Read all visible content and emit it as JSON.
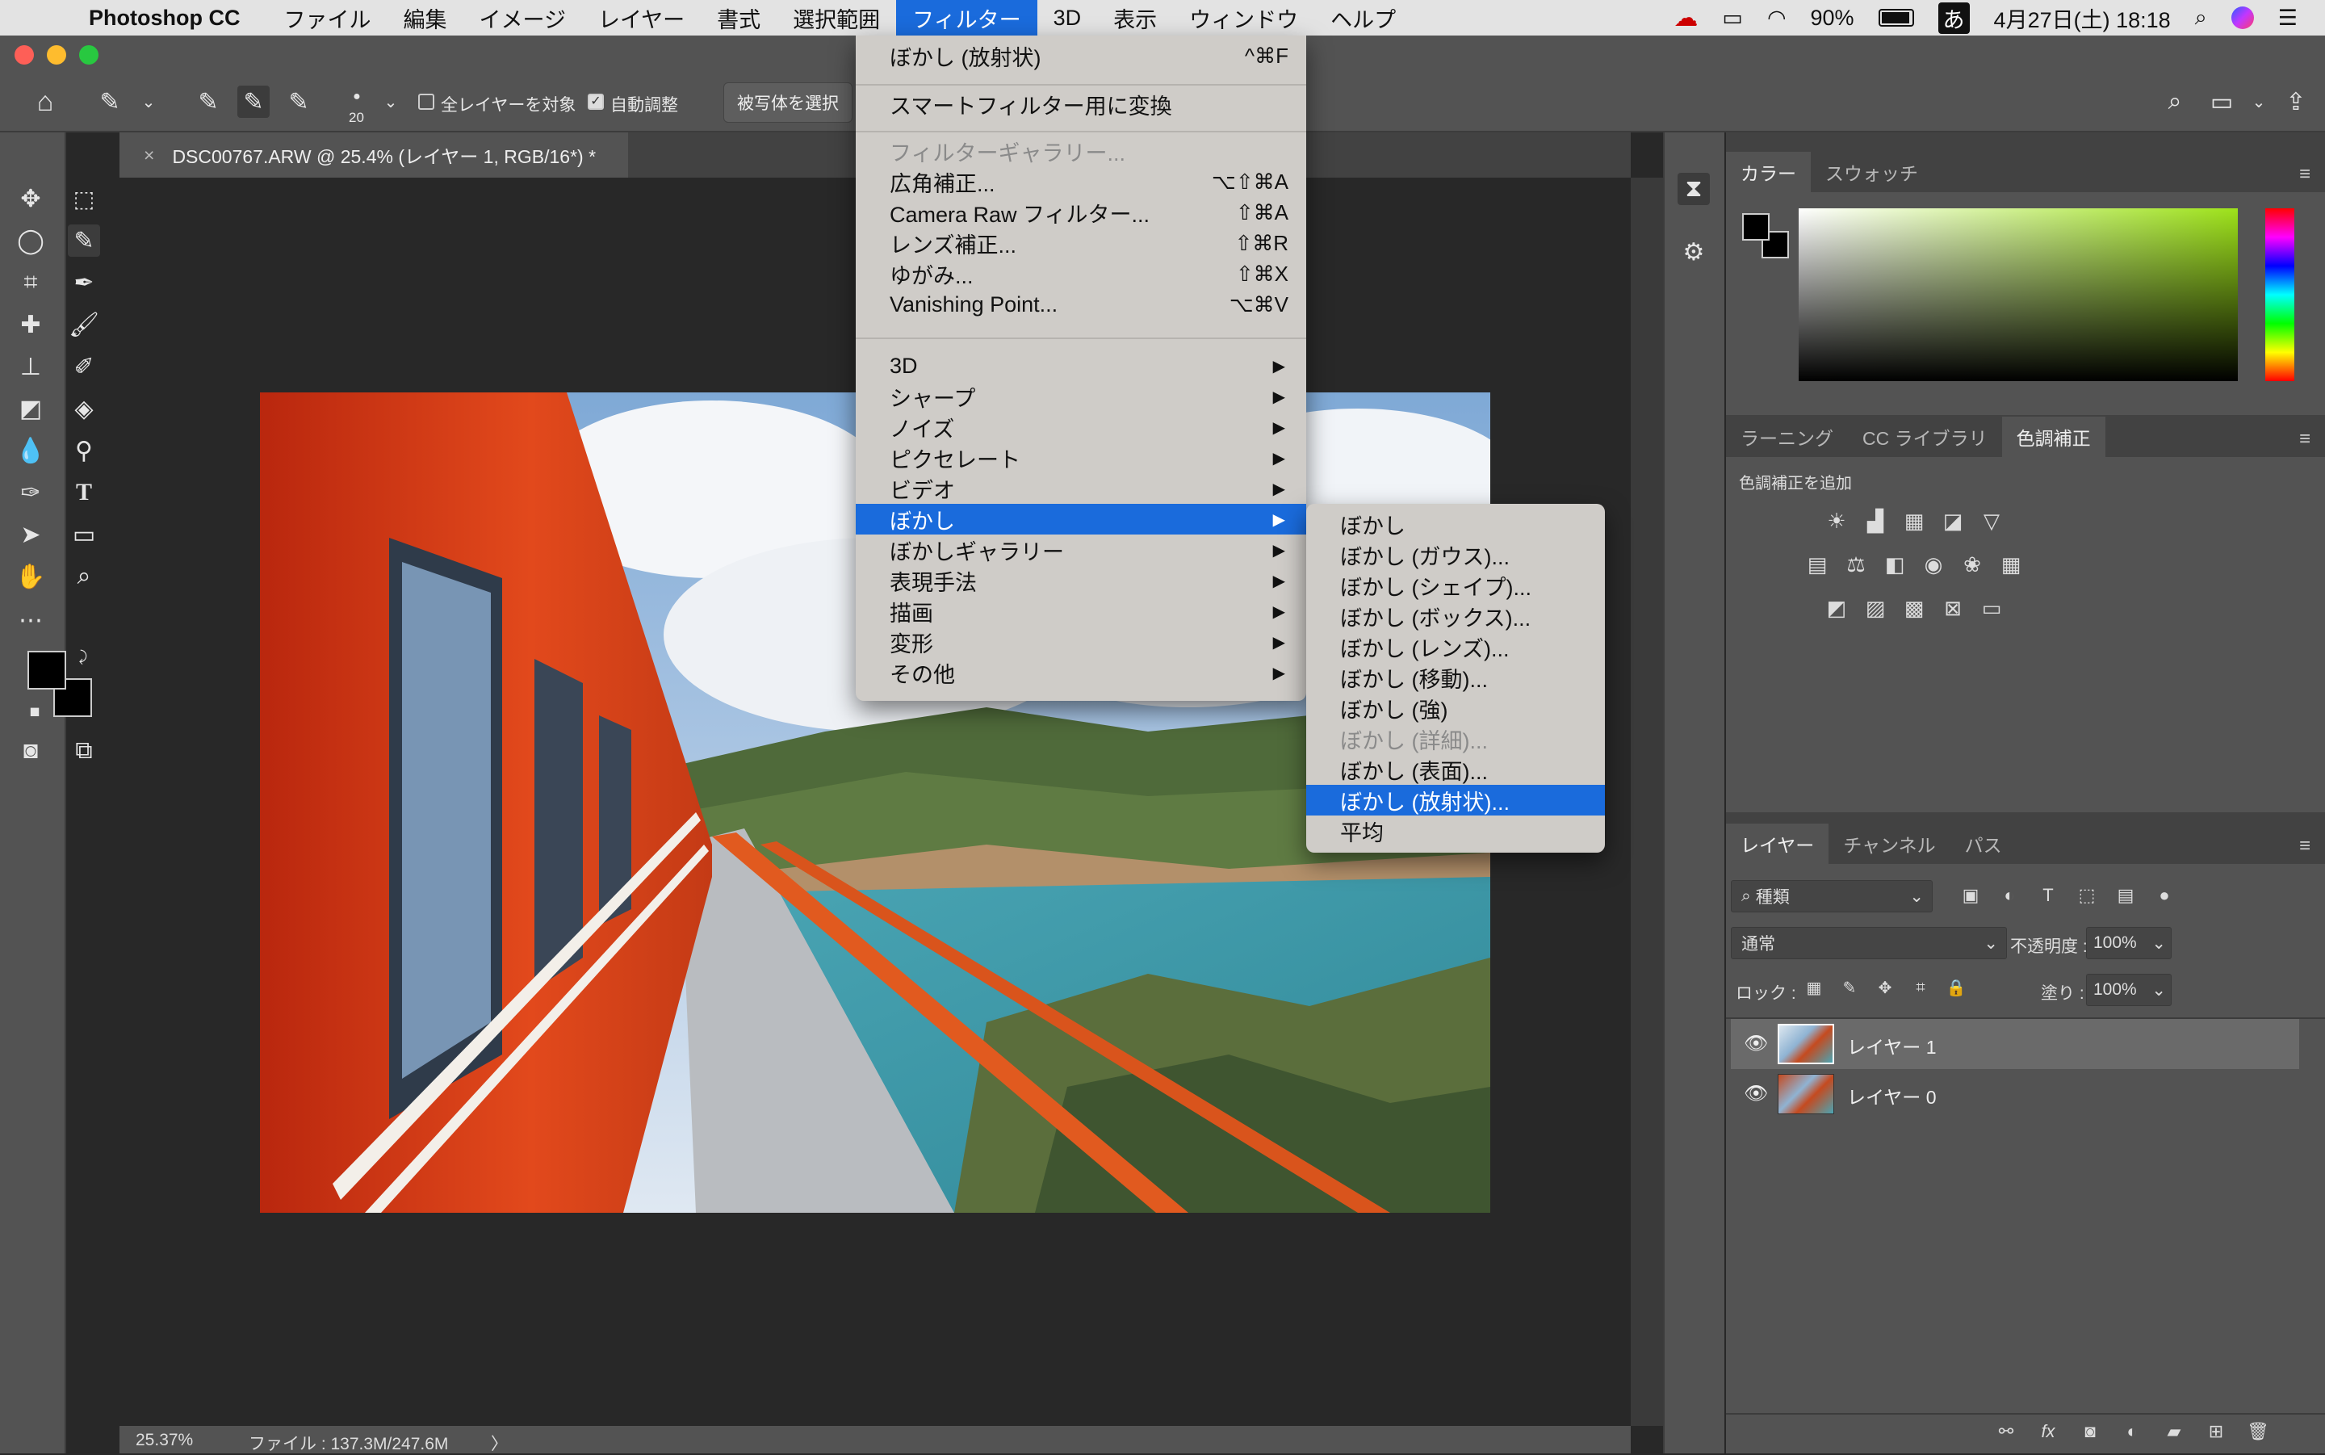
{
  "menubar": {
    "app_name": "Photoshop CC",
    "items": [
      "ファイル",
      "編集",
      "イメージ",
      "レイヤー",
      "書式",
      "選択範囲",
      "フィルター",
      "3D",
      "表示",
      "ウィンドウ",
      "ヘルプ"
    ],
    "battery": "90%",
    "input_method": "あ",
    "datetime": "4月27日(土)  18:18"
  },
  "options_bar": {
    "brush_size": "20",
    "sample_all_layers": "全レイヤーを対象",
    "auto_enhance": "自動調整",
    "select_subject": "被写体を選択"
  },
  "document": {
    "tab_title": "DSC00767.ARW @ 25.4% (レイヤー 1, RGB/16*) *",
    "close": "×"
  },
  "status": {
    "zoom": "25.37%",
    "file_info": "ファイル : 137.3M/247.6M",
    "arrow": "〉"
  },
  "filter_menu": {
    "last_filter": {
      "label": "ぼかし (放射状)",
      "shortcut": "^⌘F"
    },
    "convert_smart": "スマートフィルター用に変換",
    "gallery": "フィルターギャラリー...",
    "wide_angle": {
      "label": "広角補正...",
      "shortcut": "⌥⇧⌘A"
    },
    "camera_raw": {
      "label": "Camera Raw フィルター...",
      "shortcut": "⇧⌘A"
    },
    "lens": {
      "label": "レンズ補正...",
      "shortcut": "⇧⌘R"
    },
    "liquify": {
      "label": "ゆがみ...",
      "shortcut": "⇧⌘X"
    },
    "vanishing": {
      "label": "Vanishing Point...",
      "shortcut": "⌥⌘V"
    },
    "submenus": [
      "3D",
      "シャープ",
      "ノイズ",
      "ピクセレート",
      "ビデオ",
      "ぼかし",
      "ぼかしギャラリー",
      "表現手法",
      "描画",
      "変形",
      "その他"
    ],
    "arrow": "▶"
  },
  "blur_submenu": {
    "items": [
      "ぼかし",
      "ぼかし (ガウス)...",
      "ぼかし (シェイプ)...",
      "ぼかし (ボックス)...",
      "ぼかし (レンズ)...",
      "ぼかし (移動)...",
      "ぼかし (強)",
      "ぼかし (詳細)...",
      "ぼかし (表面)...",
      "ぼかし (放射状)...",
      "平均"
    ]
  },
  "color_panel": {
    "tabs": [
      "カラー",
      "スウォッチ"
    ],
    "menu": "≡"
  },
  "adjust_panel": {
    "tabs": [
      "ラーニング",
      "CC ライブラリ",
      "色調補正"
    ],
    "add_label": "色調補正を追加",
    "menu": "≡"
  },
  "layers_panel": {
    "tabs": [
      "レイヤー",
      "チャンネル",
      "パス"
    ],
    "menu": "≡",
    "filter_kind": "種類",
    "blend_mode": "通常",
    "opacity_label": "不透明度 :",
    "opacity": "100%",
    "lock_label": "ロック :",
    "fill_label": "塗り :",
    "fill": "100%",
    "layers": [
      {
        "name": "レイヤー 1"
      },
      {
        "name": "レイヤー 0"
      }
    ]
  },
  "colors": {
    "accent": "#1a6bdc",
    "panel": "#535353",
    "dark": "#424242"
  }
}
